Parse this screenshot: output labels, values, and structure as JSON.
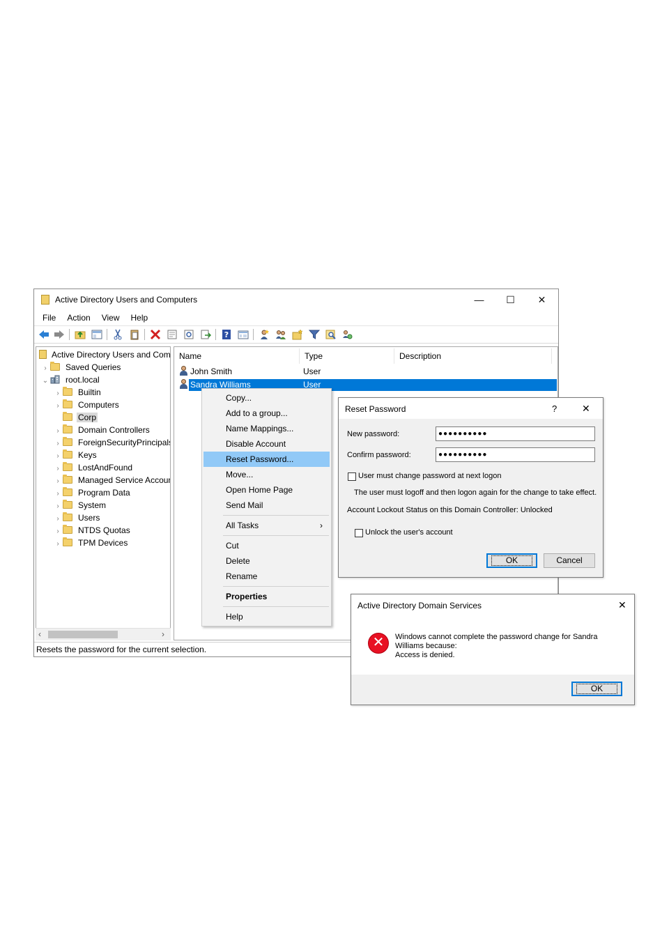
{
  "main_window": {
    "title": "Active Directory Users and Computers",
    "controls": {
      "minimize": "—",
      "maximize": "☐",
      "close": "✕"
    },
    "menu": [
      "File",
      "Action",
      "View",
      "Help"
    ],
    "toolbar_icons": [
      "back-arrow-icon",
      "forward-arrow-icon",
      "up-folder-icon",
      "show-tree-icon",
      "cut-icon",
      "paste-icon",
      "delete-icon",
      "properties-icon",
      "refresh-icon",
      "export-icon",
      "help-icon",
      "console-icon",
      "new-user-icon",
      "new-group-icon",
      "new-ou-icon",
      "filter-icon",
      "find-icon",
      "delegate-icon"
    ],
    "tree": [
      {
        "label": "Active Directory Users and Com",
        "level": 0,
        "chevron": ""
      },
      {
        "label": "Saved Queries",
        "level": 1,
        "chevron": "›"
      },
      {
        "label": "root.local",
        "level": 1,
        "chevron": "⌄"
      },
      {
        "label": "Builtin",
        "level": 2,
        "chevron": "›"
      },
      {
        "label": "Computers",
        "level": 2,
        "chevron": "›"
      },
      {
        "label": "Corp",
        "level": 2,
        "chevron": ""
      },
      {
        "label": "Domain Controllers",
        "level": 2,
        "chevron": "›"
      },
      {
        "label": "ForeignSecurityPrincipals",
        "level": 2,
        "chevron": "›"
      },
      {
        "label": "Keys",
        "level": 2,
        "chevron": "›"
      },
      {
        "label": "LostAndFound",
        "level": 2,
        "chevron": "›"
      },
      {
        "label": "Managed Service Accounts",
        "level": 2,
        "chevron": "›"
      },
      {
        "label": "Program Data",
        "level": 2,
        "chevron": "›"
      },
      {
        "label": "System",
        "level": 2,
        "chevron": "›"
      },
      {
        "label": "Users",
        "level": 2,
        "chevron": "›"
      },
      {
        "label": "NTDS Quotas",
        "level": 2,
        "chevron": "›"
      },
      {
        "label": "TPM Devices",
        "level": 2,
        "chevron": "›"
      }
    ],
    "scroll": {
      "left": "‹",
      "right": "›"
    },
    "list": {
      "columns": [
        "Name",
        "Type",
        "Description"
      ],
      "rows": [
        {
          "name": "John Smith",
          "type": "User",
          "description": ""
        },
        {
          "name": "Sandra Williams",
          "type": "User",
          "description": ""
        }
      ]
    },
    "status": "Resets the password for the current selection."
  },
  "context_menu": {
    "items": [
      "Copy...",
      "Add to a group...",
      "Name Mappings...",
      "Disable Account",
      "Reset Password...",
      "Move...",
      "Open Home Page",
      "Send Mail",
      "All Tasks",
      "Cut",
      "Delete",
      "Rename",
      "Properties",
      "Help"
    ],
    "submenu_arrow": "›"
  },
  "reset_dialog": {
    "title": "Reset Password",
    "help": "?",
    "close": "✕",
    "new_password_label": "New password:",
    "new_password_value": "●●●●●●●●●●",
    "confirm_password_label": "Confirm password:",
    "confirm_password_value": "●●●●●●●●●●",
    "must_change_label": "User must change password at next logon",
    "info_text": "The user must logoff and then logon again for the change to take effect.",
    "lockout_status": "Account Lockout Status on this Domain Controller: Unlocked",
    "unlock_label": "Unlock the user's account",
    "ok": "OK",
    "cancel": "Cancel"
  },
  "error_dialog": {
    "title": "Active Directory Domain Services",
    "close": "✕",
    "icon_glyph": "✕",
    "message_line1": "Windows cannot complete the password change for Sandra",
    "message_line2": "Williams because:",
    "message_line3": "Access is denied.",
    "ok": "OK"
  },
  "colors": {
    "selection": "#0078d7",
    "menu_highlight": "#91c9f7",
    "error_red": "#e81123"
  }
}
